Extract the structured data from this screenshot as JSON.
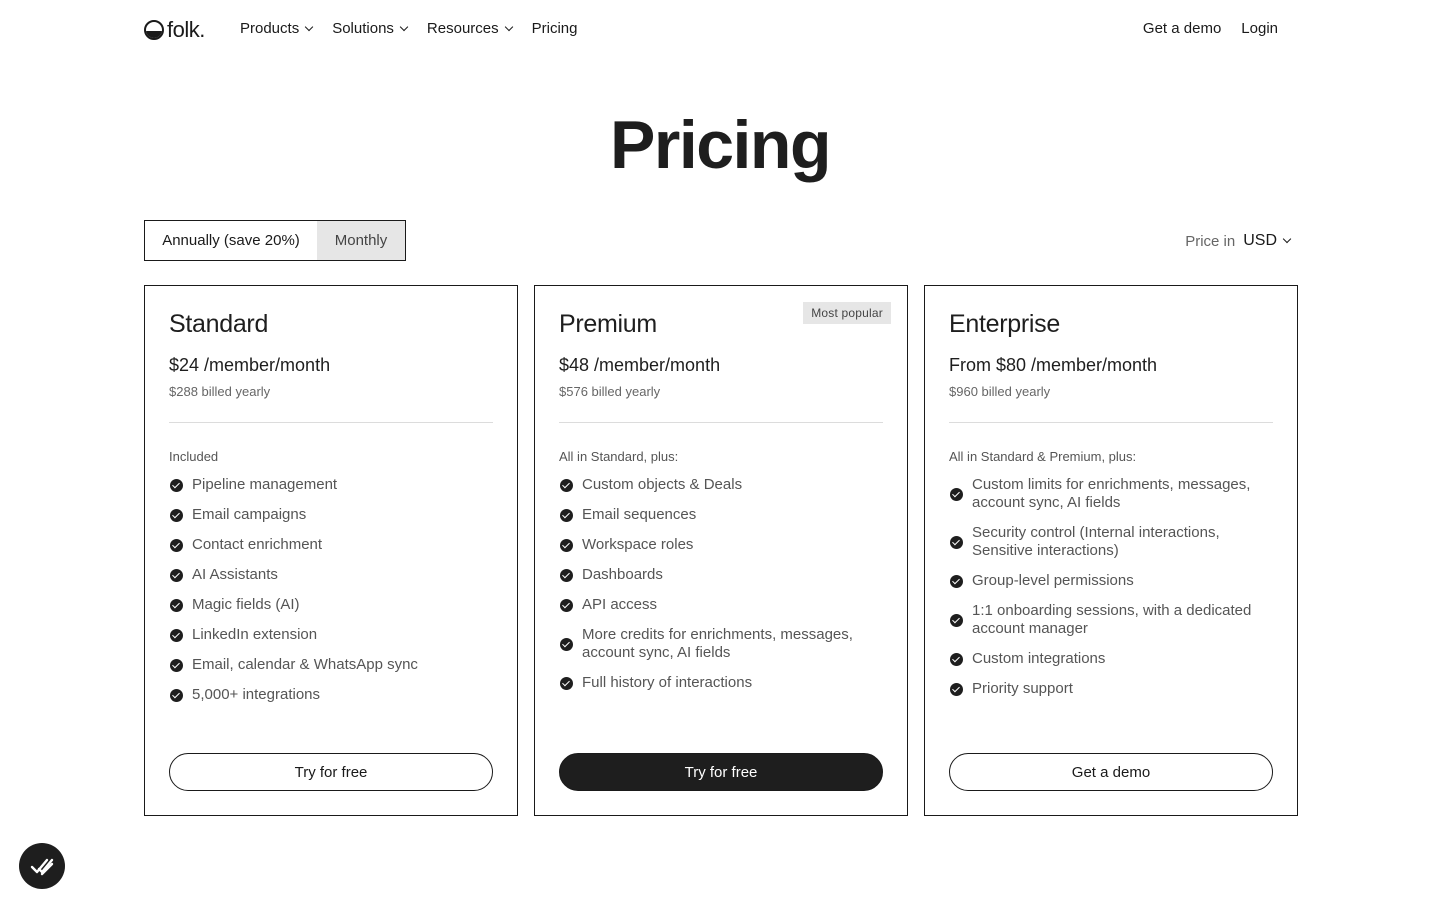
{
  "nav": {
    "logo_text": "folk.",
    "links": [
      {
        "label": "Products"
      },
      {
        "label": "Solutions"
      },
      {
        "label": "Resources"
      },
      {
        "label": "Pricing"
      }
    ],
    "right": {
      "demo": "Get a demo",
      "login": "Login"
    }
  },
  "page": {
    "title": "Pricing"
  },
  "billing": {
    "annual": "Annually (save 20%)",
    "monthly": "Monthly",
    "selected": "Annually (save 20%)"
  },
  "currency": {
    "label": "Price in",
    "value": "USD"
  },
  "plans": [
    {
      "name": "Standard",
      "price": "$24 /member/month",
      "billed": "$288 billed yearly",
      "intro": "Included",
      "features": [
        "Pipeline management",
        "Email campaigns",
        "Contact enrichment",
        "AI Assistants",
        "Magic fields (AI)",
        "LinkedIn extension",
        "Email, calendar & WhatsApp sync",
        "5,000+ integrations"
      ],
      "cta": "Try for free"
    },
    {
      "name": "Premium",
      "badge": "Most popular",
      "price": "$48 /member/month",
      "billed": "$576 billed yearly",
      "intro": "All in Standard, plus:",
      "features": [
        "Custom objects & Deals",
        "Email sequences",
        "Workspace roles",
        "Dashboards",
        "API access",
        "More credits for enrichments, messages, account sync, AI fields",
        "Full history of interactions"
      ],
      "cta": "Try for free"
    },
    {
      "name": "Enterprise",
      "price": "From $80 /member/month",
      "billed": "$960 billed yearly",
      "intro": "All in Standard & Premium, plus:",
      "features": [
        "Custom limits for enrichments, messages, account sync, AI fields",
        "Security control (Internal interactions, Sensitive interactions)",
        "Group-level permissions",
        "1:1 onboarding sessions, with a dedicated account manager",
        "Custom integrations",
        "Priority support"
      ],
      "cta": "Get a demo"
    }
  ],
  "colors": {
    "primary": "#1e1e1e",
    "muted": "#666666",
    "toggle_inactive": "#e6e6e6"
  },
  "icons": {
    "check": "check-circle-icon",
    "fab": "double-check-icon",
    "chevron": "chevron-down-icon"
  }
}
